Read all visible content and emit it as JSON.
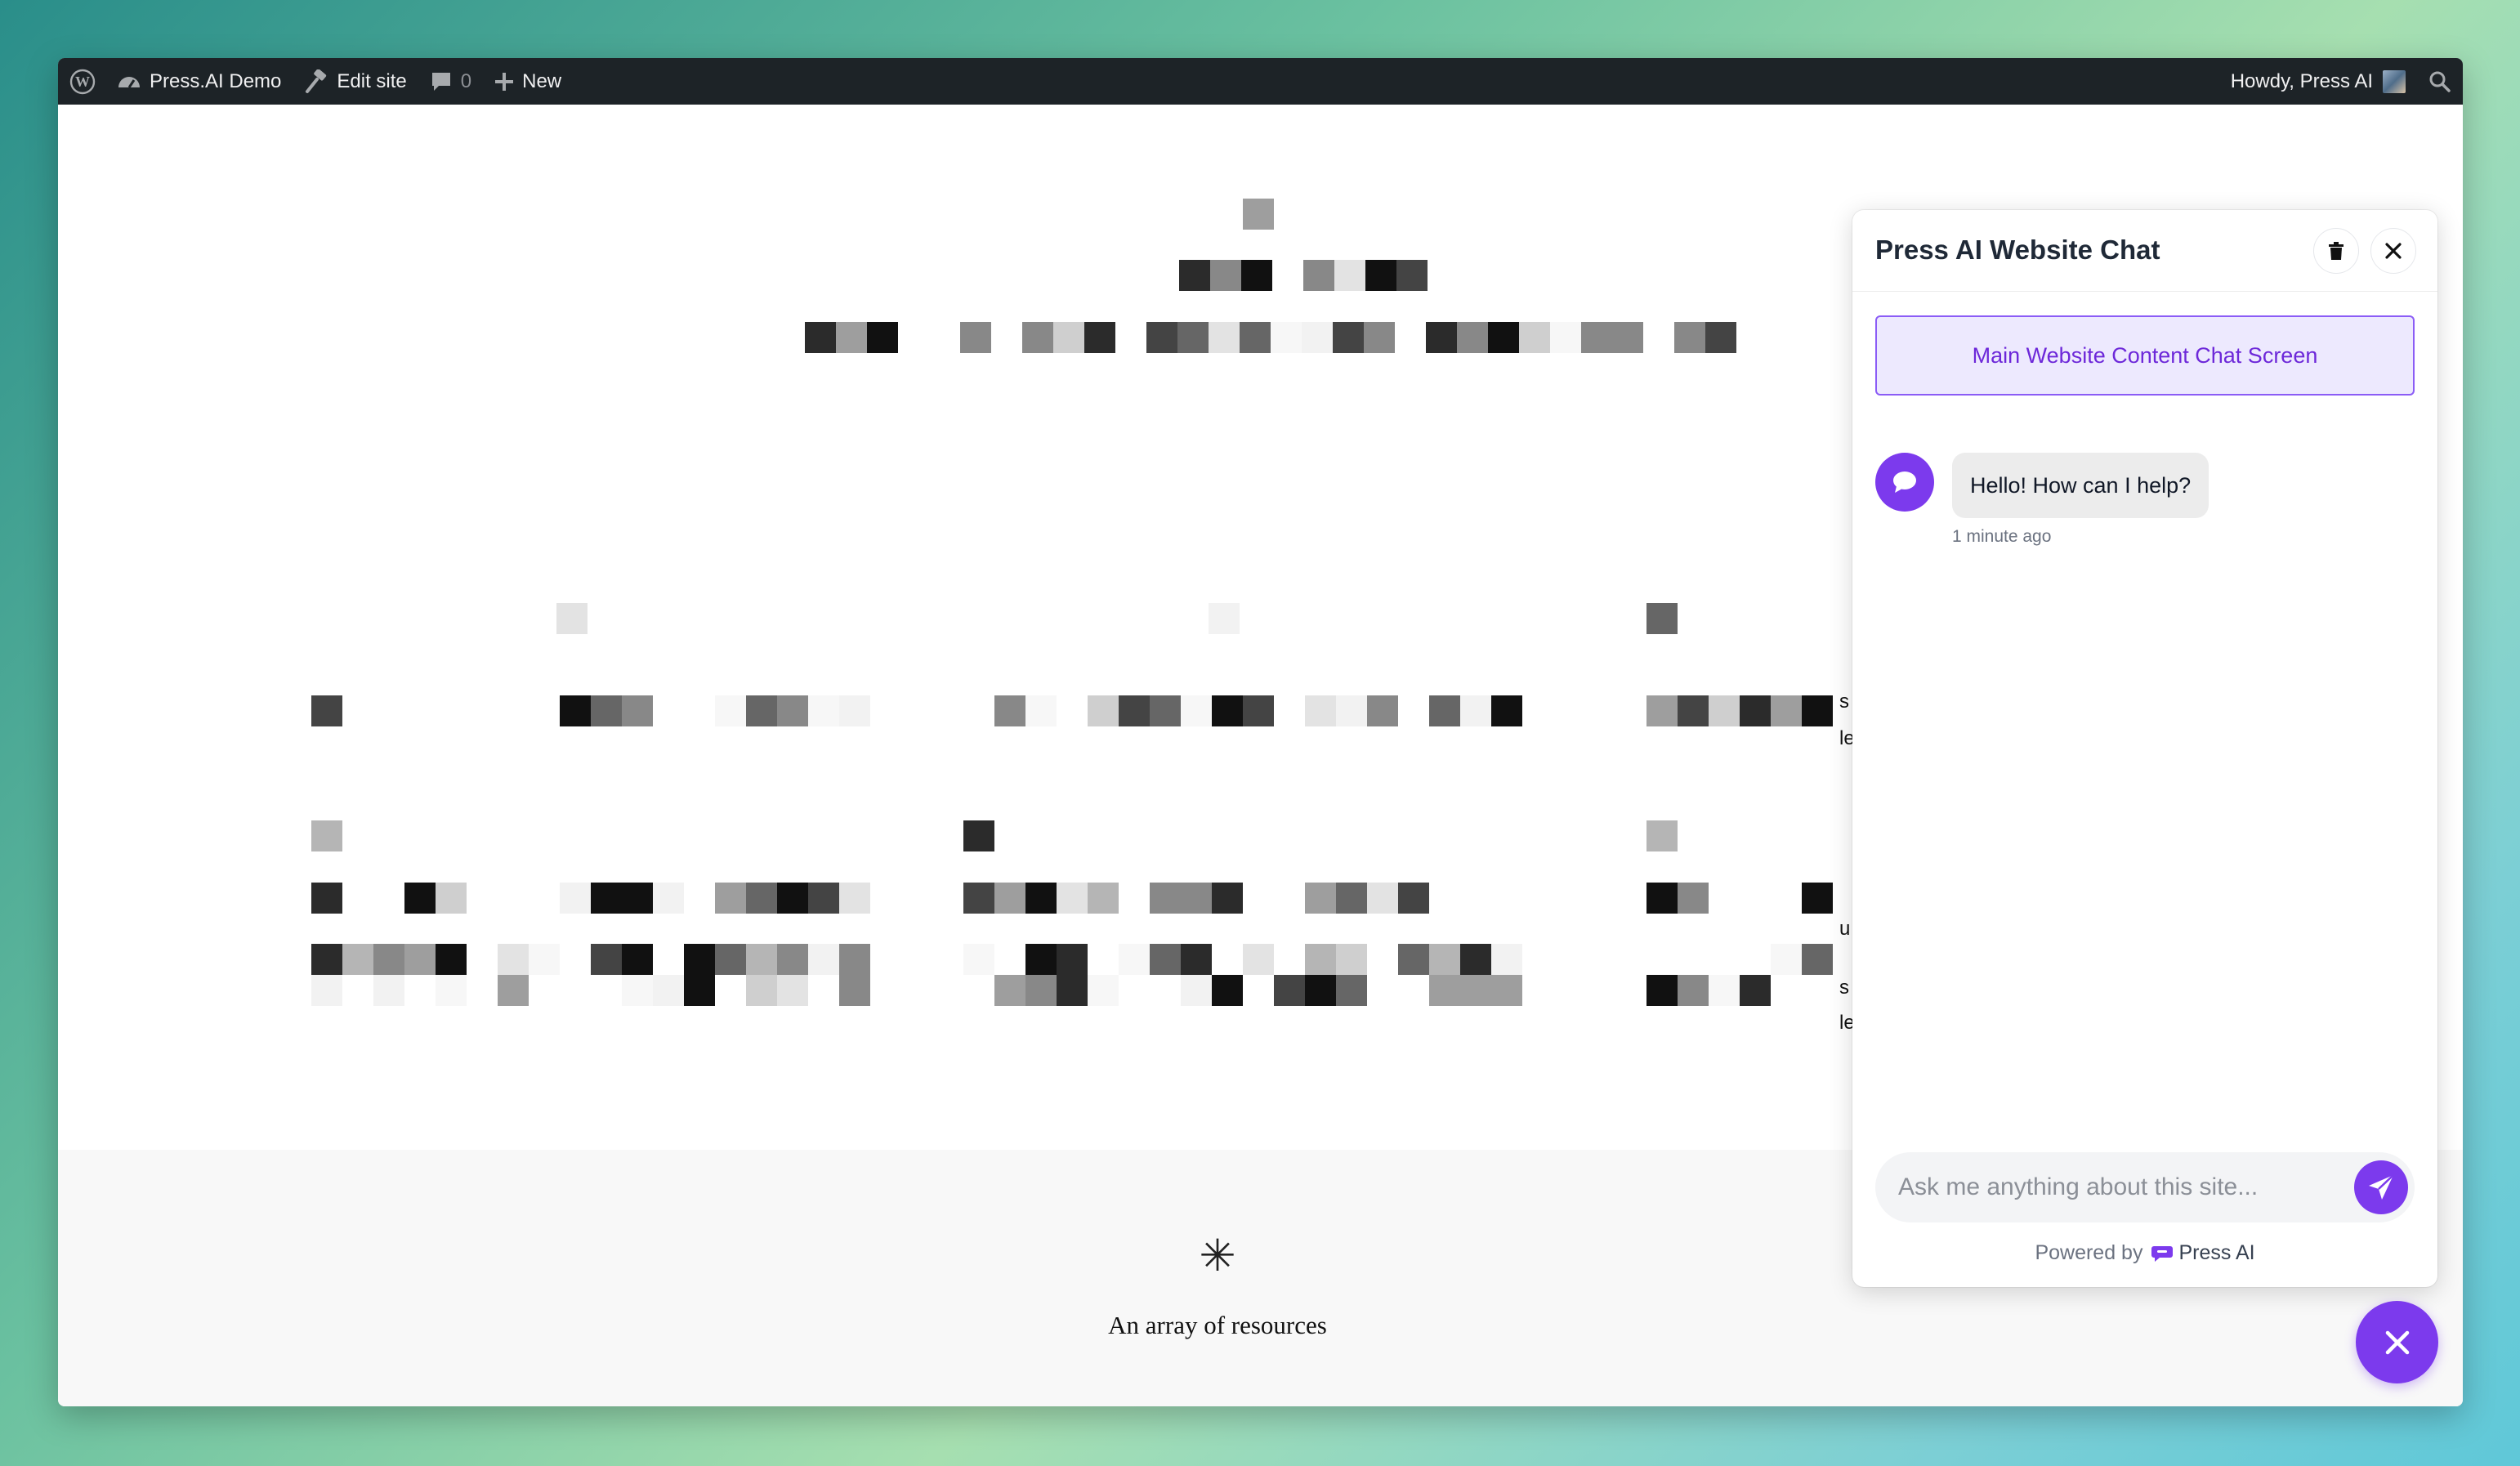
{
  "admin_bar": {
    "site_name": "Press.AI Demo",
    "edit_site": "Edit site",
    "comments_count": "0",
    "new_label": "New",
    "greeting": "Howdy, Press AI"
  },
  "footer": {
    "tagline": "An array of resources"
  },
  "chat": {
    "title": "Press AI Website Chat",
    "screen_label": "Main Website Content Chat Screen",
    "messages": [
      {
        "role": "assistant",
        "text": "Hello! How can I help?",
        "time": "1 minute ago"
      }
    ],
    "input_placeholder": "Ask me anything about this site...",
    "powered_by": "Powered by",
    "brand": "Press AI",
    "accent_color": "#7c3aed"
  }
}
